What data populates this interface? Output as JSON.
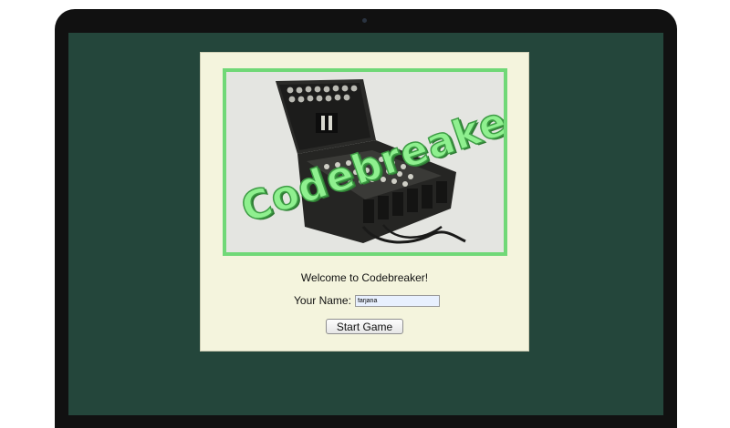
{
  "hero": {
    "title": "Codebreaker!",
    "image": "enigma-machine-photo"
  },
  "welcome_text": "Welcome to Codebreaker!",
  "name_field": {
    "label": "Your Name:",
    "value": "farjana"
  },
  "start_button_label": "Start Game",
  "colors": {
    "screen_background": "#24463b",
    "card_background": "#f4f4dd",
    "hero_border": "#70d877",
    "title_fill": "#8ff08f",
    "device_frame": "#111111"
  }
}
